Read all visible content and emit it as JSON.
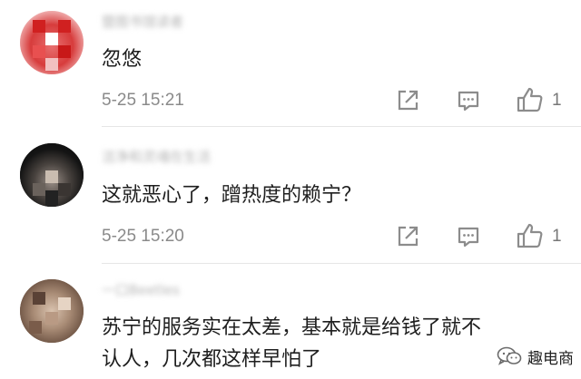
{
  "comments": [
    {
      "username": "暨图书馆读者",
      "text": "忽悠",
      "time": "5-25 15:21",
      "likes": "1",
      "avatar": "pixelated-red-avatar"
    },
    {
      "username": "洁净和灵魂在生活",
      "text": "这就恶心了，蹭热度的赖宁？",
      "time": "5-25 15:20",
      "likes": "1",
      "avatar": "pixelated-dark-avatar"
    },
    {
      "username": "一口Beetles",
      "text_line1": "苏宁的服务实在太差，基本就是给钱了就不",
      "text_line2": "认人，几次都这样早怕了",
      "avatar": "pixelated-brown-avatar"
    }
  ],
  "watermark": {
    "text": "趣电商",
    "icon": "wechat-icon"
  },
  "colors": {
    "text": "#1e1e1e",
    "meta": "#8a8a8a",
    "icon": "#8c8c8c"
  }
}
